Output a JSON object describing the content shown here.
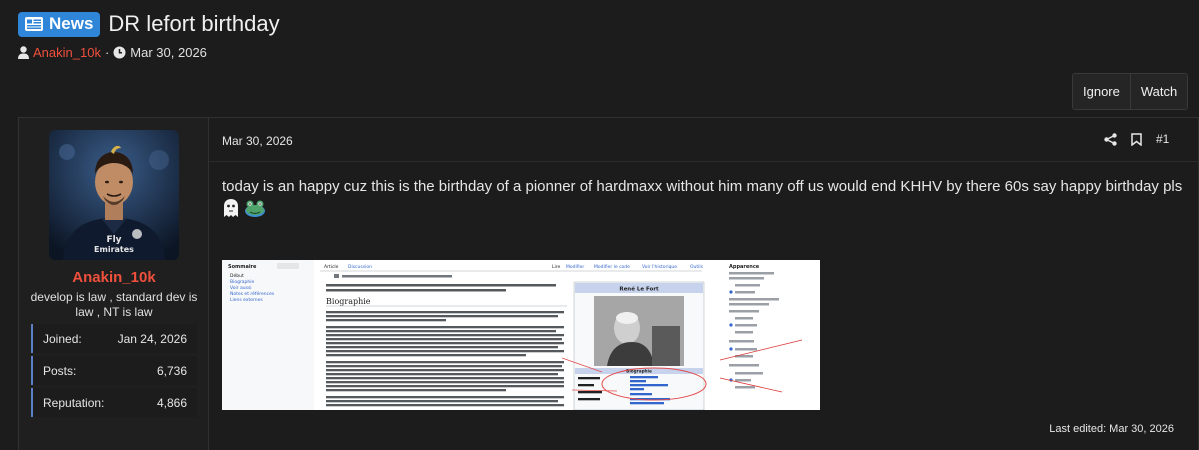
{
  "thread": {
    "prefix": "News",
    "title": "DR lefort birthday",
    "author": "Anakin_10k",
    "separator": "·",
    "date": "Mar 30, 2026"
  },
  "actions": {
    "ignore": "Ignore",
    "watch": "Watch"
  },
  "post": {
    "date": "Mar 30, 2026",
    "number": "#1",
    "body": "today is an happy cuz this is the birthday of a pionner of hardmaxx without him many off us would end KHHV by there 60s say happy birthday pls",
    "last_edited": "Last edited: Mar 30, 2026"
  },
  "user": {
    "name": "Anakin_10k",
    "title": "develop is law , standard dev is law , NT is law",
    "stats": [
      {
        "label": "Joined:",
        "value": "Jan 24, 2026"
      },
      {
        "label": "Posts:",
        "value": "6,736"
      },
      {
        "label": "Reputation:",
        "value": "4,866"
      }
    ]
  },
  "attachment": {
    "article_title": "René Le Fort",
    "section_heading": "Biographie",
    "infobox_label": "Biographie",
    "tabs": [
      "Article",
      "Discussion"
    ],
    "tools": [
      "Lire",
      "Modifier",
      "Modifier le code",
      "Voir l'historique",
      "Outils"
    ],
    "sidebar_heading": "Sommaire",
    "sidebar_items": [
      "Début",
      "Biographie",
      "Voir aussi",
      "Notes et références",
      "Liens externes"
    ],
    "appearance_heading": "Apparence"
  },
  "colors": {
    "accent": "#2f86d8",
    "username": "#f0503c",
    "stat_border": "#5d7fc4"
  },
  "icons": [
    "news-icon",
    "user-icon",
    "clock-icon",
    "share-icon",
    "bookmark-icon",
    "ghost-emoji-icon",
    "frog-emoji-icon"
  ]
}
